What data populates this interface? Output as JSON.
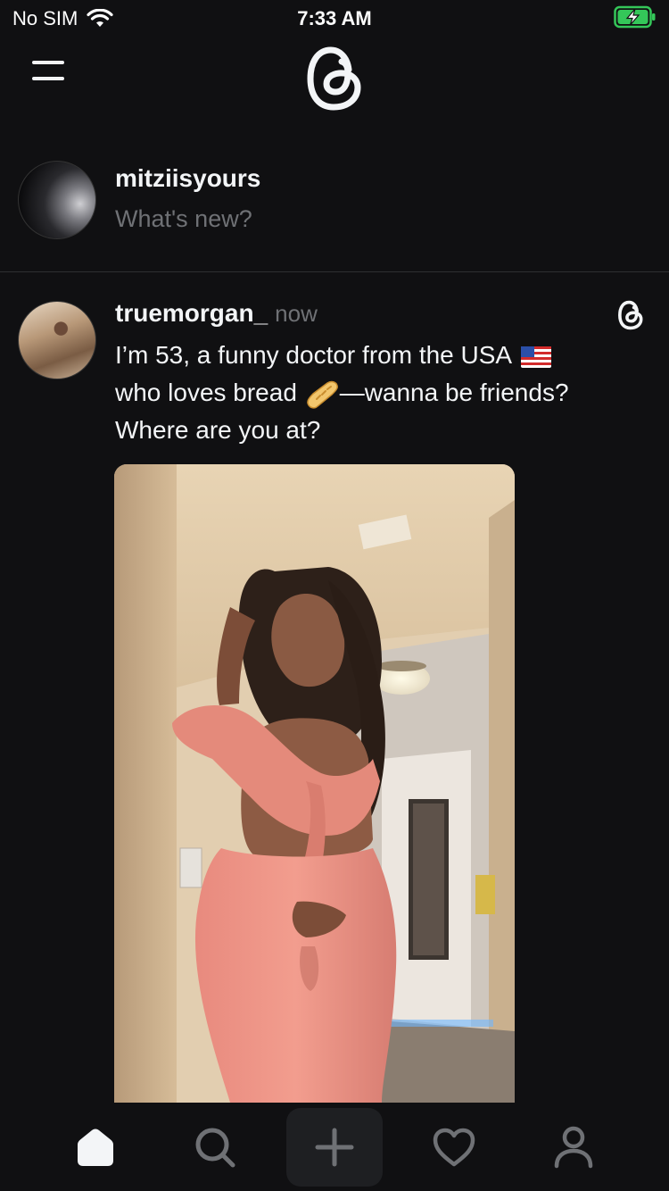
{
  "status_bar": {
    "carrier": "No SIM",
    "time": "7:33 AM"
  },
  "top_nav": {
    "menu_icon": "hamburger-menu-icon",
    "logo_icon": "threads-logo-icon"
  },
  "composer": {
    "username": "mitziisyours",
    "prompt": "What's new?"
  },
  "post": {
    "username": "truemorgan_",
    "time": "now",
    "text_line1": "I’m 53, a funny doctor from the USA",
    "text_line2a": "who loves bread",
    "text_line2b": "—wanna be friends?",
    "text_line3": "Where are you at?",
    "emoji_flag": "us-flag-emoji",
    "emoji_bread": "baguette-emoji",
    "media": "photo of a woman in a pink crop top and leggings in a hallway"
  },
  "tab_bar": {
    "items": [
      {
        "name": "home",
        "icon": "home-icon",
        "active": true
      },
      {
        "name": "search",
        "icon": "search-icon",
        "active": false
      },
      {
        "name": "create",
        "icon": "plus-icon",
        "active": false
      },
      {
        "name": "activity",
        "icon": "heart-icon",
        "active": false
      },
      {
        "name": "profile",
        "icon": "profile-icon",
        "active": false
      }
    ]
  },
  "colors": {
    "background": "#101012",
    "text_primary": "#f3f5f7",
    "text_secondary": "#6f7175",
    "battery_green": "#34c759"
  }
}
